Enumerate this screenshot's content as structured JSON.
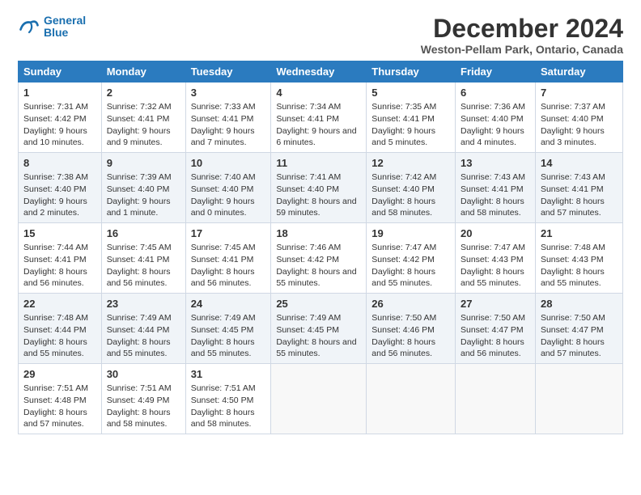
{
  "logo": {
    "line1": "General",
    "line2": "Blue"
  },
  "title": "December 2024",
  "subtitle": "Weston-Pellam Park, Ontario, Canada",
  "days_of_week": [
    "Sunday",
    "Monday",
    "Tuesday",
    "Wednesday",
    "Thursday",
    "Friday",
    "Saturday"
  ],
  "weeks": [
    [
      {
        "day": 1,
        "rise": "7:31 AM",
        "set": "4:42 PM",
        "daylight": "9 hours and 10 minutes."
      },
      {
        "day": 2,
        "rise": "7:32 AM",
        "set": "4:41 PM",
        "daylight": "9 hours and 9 minutes."
      },
      {
        "day": 3,
        "rise": "7:33 AM",
        "set": "4:41 PM",
        "daylight": "9 hours and 7 minutes."
      },
      {
        "day": 4,
        "rise": "7:34 AM",
        "set": "4:41 PM",
        "daylight": "9 hours and 6 minutes."
      },
      {
        "day": 5,
        "rise": "7:35 AM",
        "set": "4:41 PM",
        "daylight": "9 hours and 5 minutes."
      },
      {
        "day": 6,
        "rise": "7:36 AM",
        "set": "4:40 PM",
        "daylight": "9 hours and 4 minutes."
      },
      {
        "day": 7,
        "rise": "7:37 AM",
        "set": "4:40 PM",
        "daylight": "9 hours and 3 minutes."
      }
    ],
    [
      {
        "day": 8,
        "rise": "7:38 AM",
        "set": "4:40 PM",
        "daylight": "9 hours and 2 minutes."
      },
      {
        "day": 9,
        "rise": "7:39 AM",
        "set": "4:40 PM",
        "daylight": "9 hours and 1 minute."
      },
      {
        "day": 10,
        "rise": "7:40 AM",
        "set": "4:40 PM",
        "daylight": "9 hours and 0 minutes."
      },
      {
        "day": 11,
        "rise": "7:41 AM",
        "set": "4:40 PM",
        "daylight": "8 hours and 59 minutes."
      },
      {
        "day": 12,
        "rise": "7:42 AM",
        "set": "4:40 PM",
        "daylight": "8 hours and 58 minutes."
      },
      {
        "day": 13,
        "rise": "7:43 AM",
        "set": "4:41 PM",
        "daylight": "8 hours and 58 minutes."
      },
      {
        "day": 14,
        "rise": "7:43 AM",
        "set": "4:41 PM",
        "daylight": "8 hours and 57 minutes."
      }
    ],
    [
      {
        "day": 15,
        "rise": "7:44 AM",
        "set": "4:41 PM",
        "daylight": "8 hours and 56 minutes."
      },
      {
        "day": 16,
        "rise": "7:45 AM",
        "set": "4:41 PM",
        "daylight": "8 hours and 56 minutes."
      },
      {
        "day": 17,
        "rise": "7:45 AM",
        "set": "4:41 PM",
        "daylight": "8 hours and 56 minutes."
      },
      {
        "day": 18,
        "rise": "7:46 AM",
        "set": "4:42 PM",
        "daylight": "8 hours and 55 minutes."
      },
      {
        "day": 19,
        "rise": "7:47 AM",
        "set": "4:42 PM",
        "daylight": "8 hours and 55 minutes."
      },
      {
        "day": 20,
        "rise": "7:47 AM",
        "set": "4:43 PM",
        "daylight": "8 hours and 55 minutes."
      },
      {
        "day": 21,
        "rise": "7:48 AM",
        "set": "4:43 PM",
        "daylight": "8 hours and 55 minutes."
      }
    ],
    [
      {
        "day": 22,
        "rise": "7:48 AM",
        "set": "4:44 PM",
        "daylight": "8 hours and 55 minutes."
      },
      {
        "day": 23,
        "rise": "7:49 AM",
        "set": "4:44 PM",
        "daylight": "8 hours and 55 minutes."
      },
      {
        "day": 24,
        "rise": "7:49 AM",
        "set": "4:45 PM",
        "daylight": "8 hours and 55 minutes."
      },
      {
        "day": 25,
        "rise": "7:49 AM",
        "set": "4:45 PM",
        "daylight": "8 hours and 55 minutes."
      },
      {
        "day": 26,
        "rise": "7:50 AM",
        "set": "4:46 PM",
        "daylight": "8 hours and 56 minutes."
      },
      {
        "day": 27,
        "rise": "7:50 AM",
        "set": "4:47 PM",
        "daylight": "8 hours and 56 minutes."
      },
      {
        "day": 28,
        "rise": "7:50 AM",
        "set": "4:47 PM",
        "daylight": "8 hours and 57 minutes."
      }
    ],
    [
      {
        "day": 29,
        "rise": "7:51 AM",
        "set": "4:48 PM",
        "daylight": "8 hours and 57 minutes."
      },
      {
        "day": 30,
        "rise": "7:51 AM",
        "set": "4:49 PM",
        "daylight": "8 hours and 58 minutes."
      },
      {
        "day": 31,
        "rise": "7:51 AM",
        "set": "4:50 PM",
        "daylight": "8 hours and 58 minutes."
      },
      null,
      null,
      null,
      null
    ]
  ],
  "colors": {
    "header_bg": "#2b7bbf",
    "accent": "#1a6faf"
  }
}
